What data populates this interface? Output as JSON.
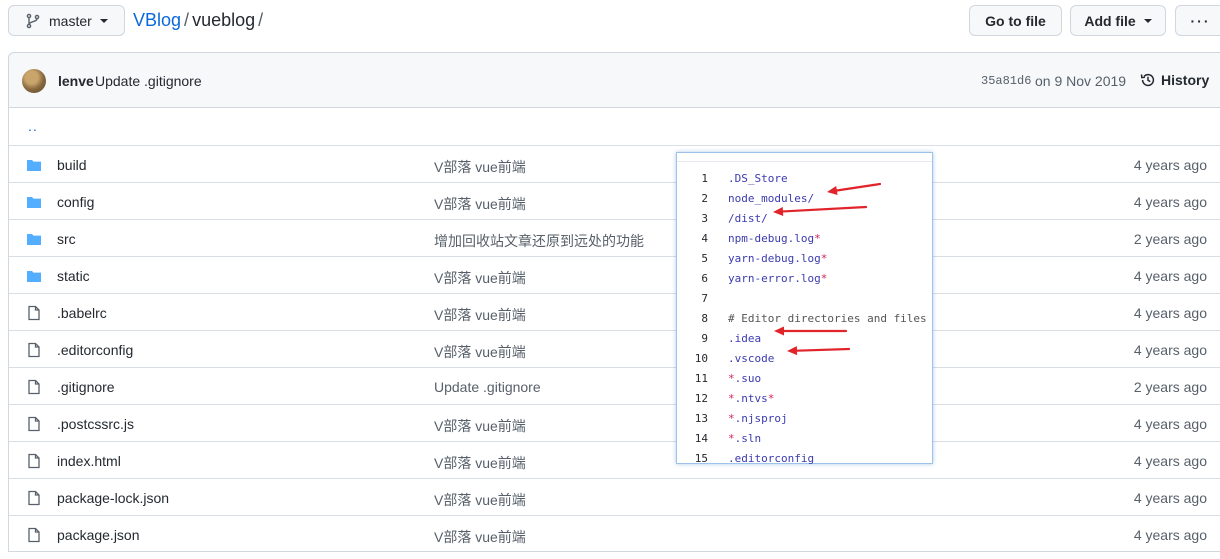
{
  "branch": {
    "name": "master"
  },
  "breadcrumb": {
    "owner": "VBlog",
    "separator": "/",
    "repo": "vueblog",
    "trailing": "/"
  },
  "actions": {
    "goto_label": "Go to file",
    "addfile_label": "Add file",
    "more_label": "···"
  },
  "commit": {
    "author": "lenve",
    "message": "Update .gitignore",
    "hash": "35a81d6",
    "date": "on 9 Nov 2019",
    "history_label": "History"
  },
  "parent_link": "..",
  "files": [
    {
      "name": "build",
      "type": "dir",
      "message": "V部落 vue前端",
      "age": "4 years ago"
    },
    {
      "name": "config",
      "type": "dir",
      "message": "V部落 vue前端",
      "age": "4 years ago"
    },
    {
      "name": "src",
      "type": "dir",
      "message": "增加回收站文章还原到远处的功能",
      "age": "2 years ago"
    },
    {
      "name": "static",
      "type": "dir",
      "message": "V部落 vue前端",
      "age": "4 years ago"
    },
    {
      "name": ".babelrc",
      "type": "file",
      "message": "V部落 vue前端",
      "age": "4 years ago"
    },
    {
      "name": ".editorconfig",
      "type": "file",
      "message": "V部落 vue前端",
      "age": "4 years ago"
    },
    {
      "name": ".gitignore",
      "type": "file",
      "message": "Update .gitignore",
      "age": "2 years ago"
    },
    {
      "name": ".postcssrc.js",
      "type": "file",
      "message": "V部落 vue前端",
      "age": "4 years ago"
    },
    {
      "name": "index.html",
      "type": "file",
      "message": "V部落 vue前端",
      "age": "4 years ago"
    },
    {
      "name": "package-lock.json",
      "type": "file",
      "message": "V部落 vue前端",
      "age": "4 years ago"
    },
    {
      "name": "package.json",
      "type": "file",
      "message": "V部落 vue前端",
      "age": "4 years ago"
    }
  ],
  "snippet": {
    "lines": [
      {
        "n": "1",
        "text": ".DS_Store",
        "star": ""
      },
      {
        "n": "2",
        "text": "node_modules/",
        "star": ""
      },
      {
        "n": "3",
        "text": "/dist/",
        "star": ""
      },
      {
        "n": "4",
        "text": "npm-debug.log",
        "star": "*"
      },
      {
        "n": "5",
        "text": "yarn-debug.log",
        "star": "*"
      },
      {
        "n": "6",
        "text": "yarn-error.log",
        "star": "*"
      },
      {
        "n": "7",
        "text": "",
        "star": ""
      },
      {
        "n": "8",
        "text": "# Editor directories and files",
        "star": "",
        "comment": true
      },
      {
        "n": "9",
        "text": ".idea",
        "star": ""
      },
      {
        "n": "10",
        "text": ".vscode",
        "star": ""
      },
      {
        "n": "11",
        "text": ".suo",
        "star": "*",
        "prefix": true
      },
      {
        "n": "12",
        "text": ".ntvs",
        "star": "*",
        "prefix": true,
        "suffix": true
      },
      {
        "n": "13",
        "text": ".njsproj",
        "star": "*",
        "prefix": true
      },
      {
        "n": "14",
        "text": ".sln",
        "star": "*",
        "prefix": true
      },
      {
        "n": "15",
        "text": ".editorconfig",
        "star": ""
      }
    ],
    "highlighted_lines": [
      2,
      3,
      9,
      10
    ]
  },
  "colors": {
    "link": "#0969da",
    "folder": "#54aeff",
    "arrow": "#e0242a",
    "code": "#3b3bb0",
    "star": "#d0245e"
  }
}
